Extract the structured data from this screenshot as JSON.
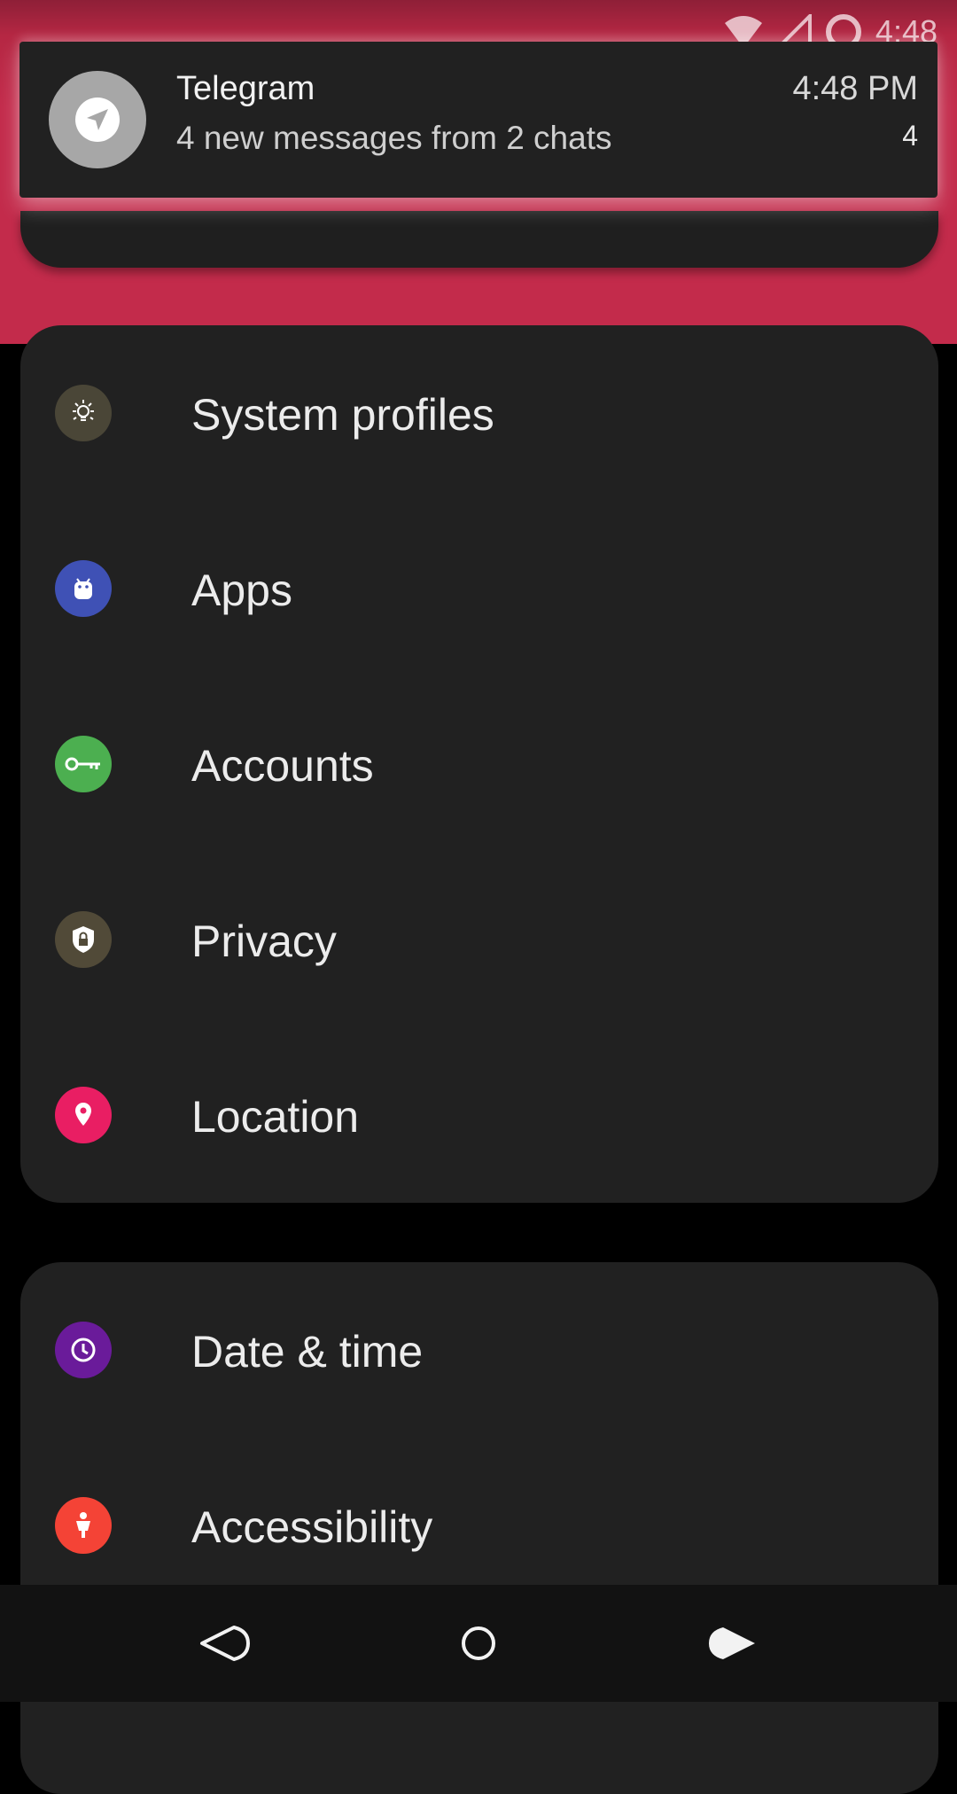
{
  "statusbar": {
    "time": "4:48"
  },
  "notification": {
    "app": "Telegram",
    "text": "4 new messages from 2 chats",
    "time": "4:48 PM",
    "count": "4",
    "icon": "telegram-send-icon"
  },
  "settings": {
    "group1": [
      {
        "label": "System profiles",
        "icon": "lightbulb-icon",
        "color": "#4a4637"
      },
      {
        "label": "Apps",
        "icon": "android-icon",
        "color": "#3f51b5"
      },
      {
        "label": "Accounts",
        "icon": "key-icon",
        "color": "#4caf50"
      },
      {
        "label": "Privacy",
        "icon": "shield-lock-icon",
        "color": "#514a38"
      },
      {
        "label": "Location",
        "icon": "location-pin-icon",
        "color": "#e91e63"
      }
    ],
    "group2": [
      {
        "label": "Date & time",
        "icon": "clock-icon",
        "color": "#6a1b9a"
      },
      {
        "label": "Accessibility",
        "icon": "accessibility-icon",
        "color": "#f44336"
      }
    ]
  },
  "navbar": {
    "back": "back-icon",
    "home": "home-icon",
    "recents": "recents-icon"
  }
}
